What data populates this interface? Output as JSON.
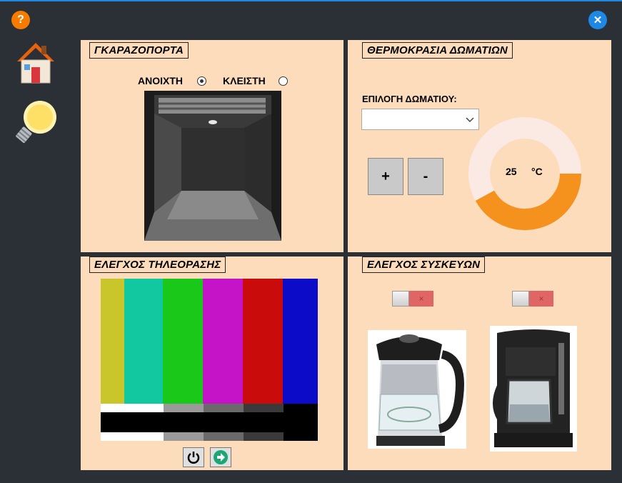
{
  "header": {
    "help_icon": "question-mark",
    "help_color": "#f57c00",
    "close_icon": "x-mark",
    "close_color": "#1e88e5"
  },
  "sidebar": {
    "items": [
      {
        "name": "home",
        "icon": "house-icon"
      },
      {
        "name": "lighting",
        "icon": "lightbulb-icon"
      }
    ]
  },
  "garage": {
    "title": "ΓΚΑΡΑΖΟΠΟΡΤΑ",
    "open_label": "ΑΝΟΙΧΤΗ",
    "closed_label": "ΚΛΕΙΣΤΗ",
    "selected": "open"
  },
  "temperature": {
    "title": "ΘΕΡΜΟΚΡΑΣΙΑ ΔΩΜΑΤΙΩΝ",
    "room_label": "ΕΠΙΛΟΓΗ ΔΩΜΑΤΙΟΥ:",
    "room_value": "",
    "plus_label": "+",
    "minus_label": "-",
    "value": "25",
    "unit": "°C",
    "gauge_fraction": 0.42,
    "gauge_color": "#f5921e",
    "gauge_track_color": "#fbe9e4"
  },
  "tv": {
    "title": "ΕΛΕΓΧΟΣ ΤΗΛΕΟΡΑΣΗΣ",
    "power_icon": "power-icon",
    "next_icon": "arrow-right-icon",
    "bar_colors": [
      "#c9c62c",
      "#12c8a0",
      "#1ac81a",
      "#c514c8",
      "#c90b0b",
      "#0b0bc8"
    ]
  },
  "devices": {
    "title": "ΕΛΕΓΧΟΣ ΣΥΣΚΕΥΩΝ",
    "toggles": [
      {
        "name": "kettle",
        "state": "off",
        "off_symbol": "×"
      },
      {
        "name": "coffee-maker",
        "state": "off",
        "off_symbol": "×"
      }
    ]
  }
}
